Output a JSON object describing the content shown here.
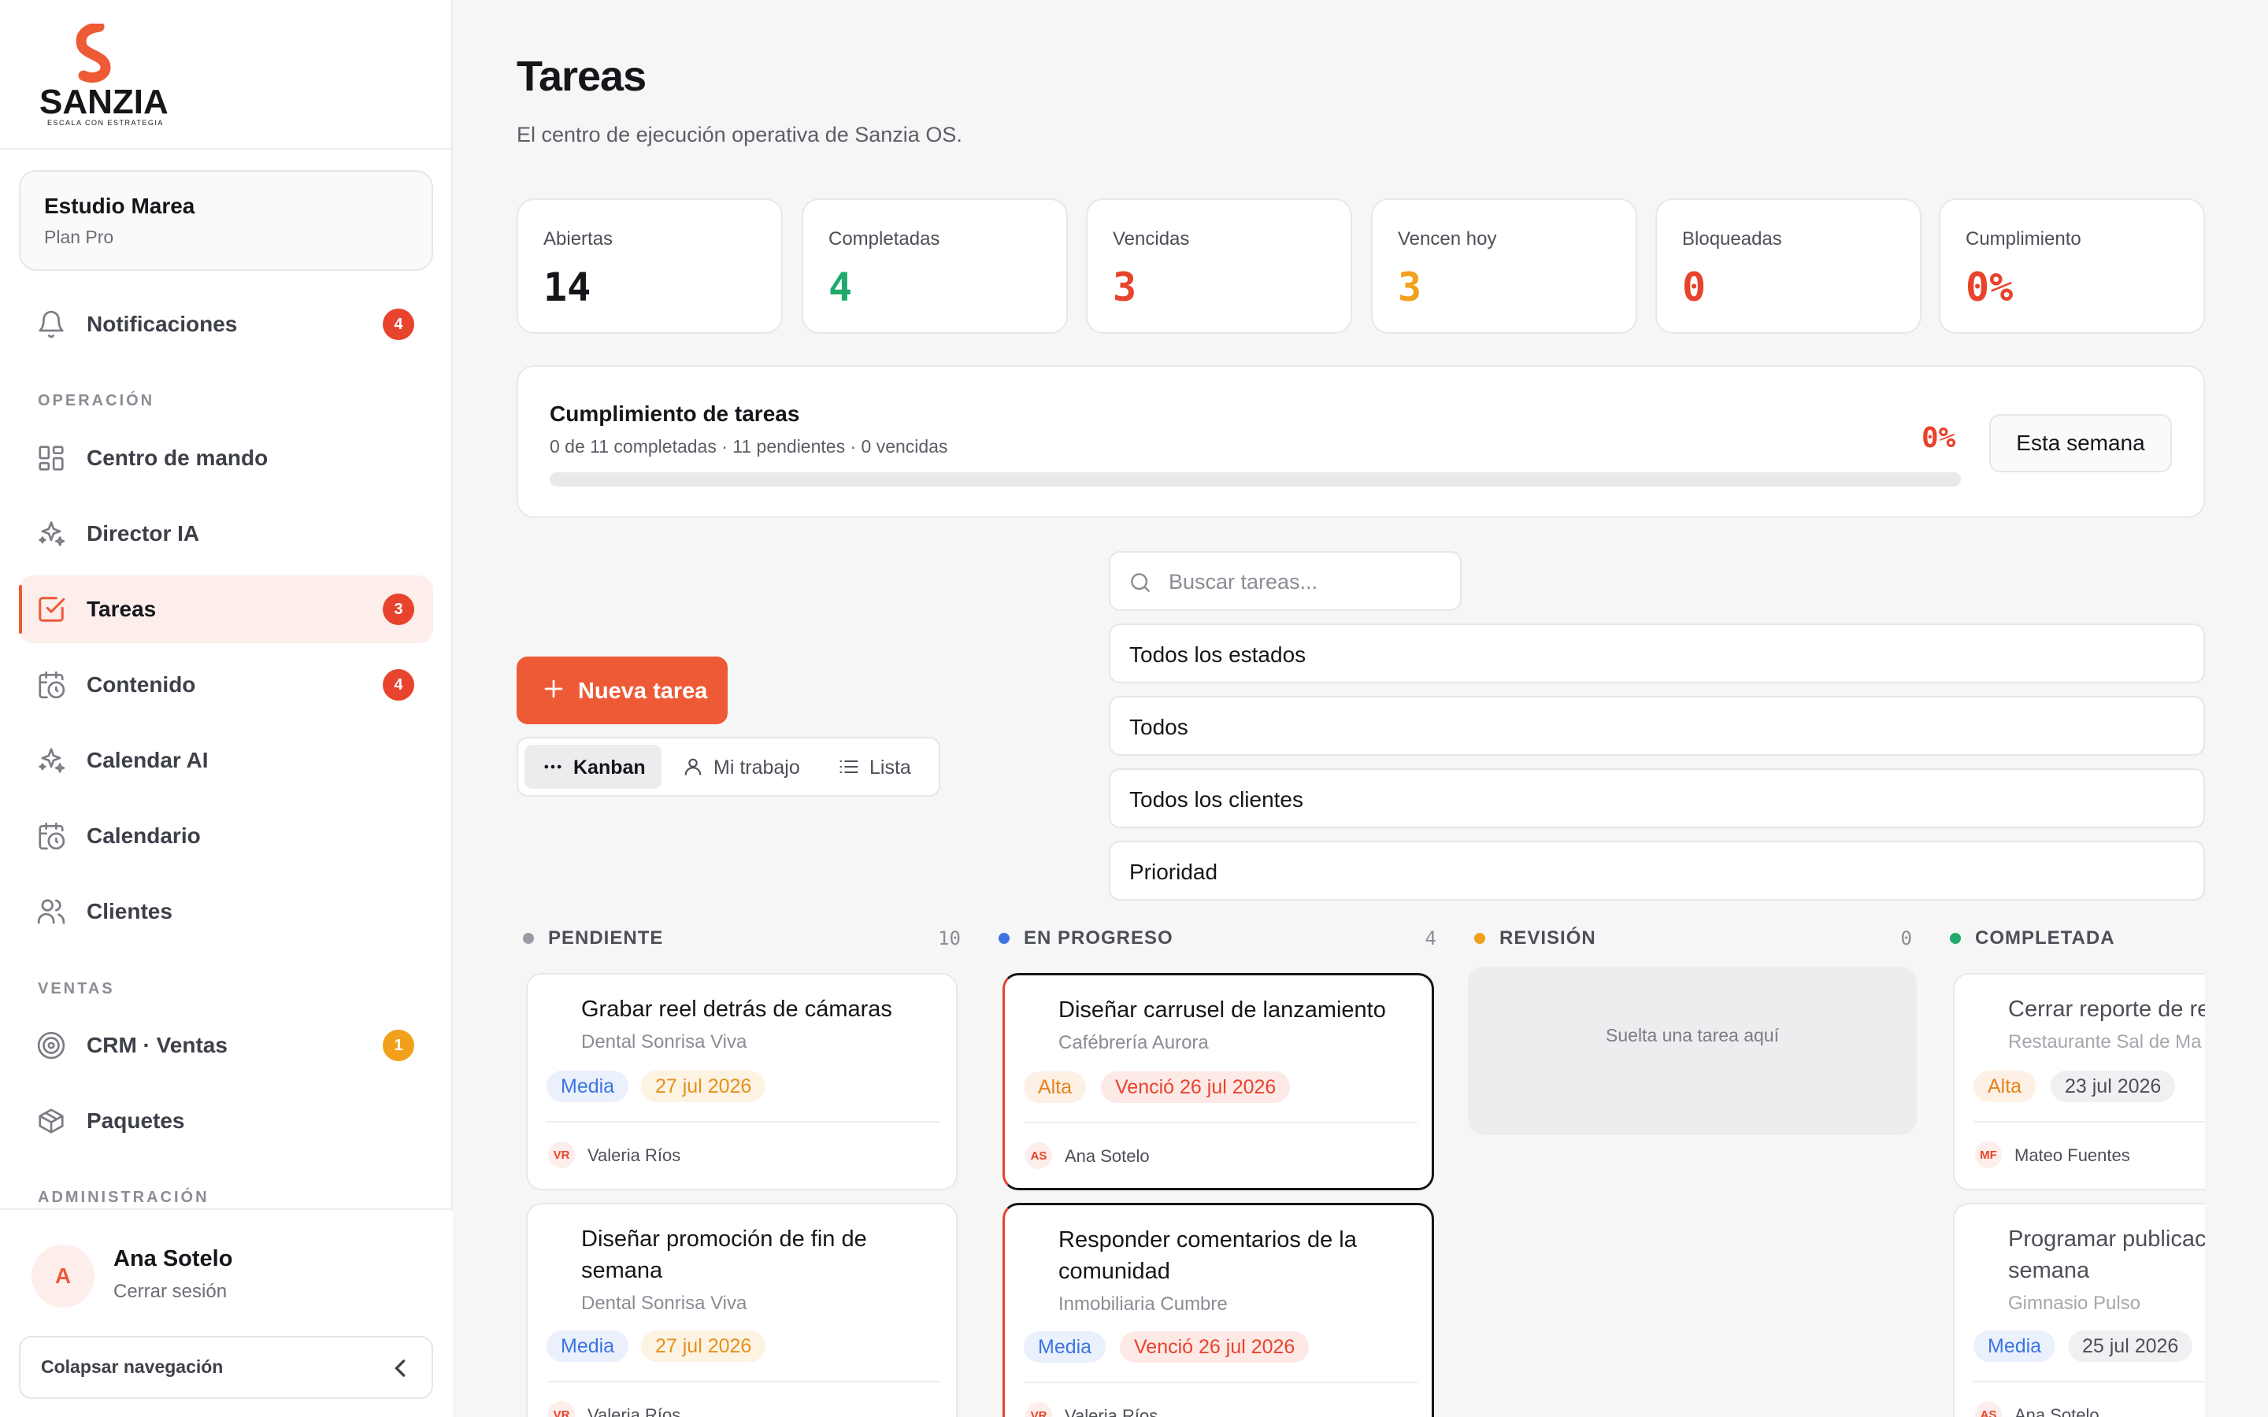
{
  "brand": {
    "name": "SANZIA",
    "tagline": "ESCALA CON ESTRATEGIA",
    "accent": "#ee5a36"
  },
  "workspace": {
    "name": "Estudio Marea",
    "plan": "Plan Pro"
  },
  "sidebar": {
    "notifications": {
      "label": "Notificaciones",
      "badge": "4",
      "icon": "bell-icon"
    },
    "sections": {
      "operacion": "OPERACIÓN",
      "ventas": "VENTAS",
      "administracion": "ADMINISTRACIÓN"
    },
    "items": [
      {
        "label": "Centro de mando",
        "icon": "grid-icon"
      },
      {
        "label": "Director IA",
        "icon": "sparkles-icon"
      },
      {
        "label": "Tareas",
        "icon": "checkbox-icon",
        "badge": "3",
        "active": true
      },
      {
        "label": "Contenido",
        "icon": "calendar-clock-icon",
        "badge": "4"
      },
      {
        "label": "Calendar AI",
        "icon": "sparkles-icon"
      },
      {
        "label": "Calendario",
        "icon": "calendar-clock-icon"
      },
      {
        "label": "Clientes",
        "icon": "users-icon"
      },
      {
        "label": "CRM · Ventas",
        "icon": "target-icon",
        "badge": "1"
      },
      {
        "label": "Paquetes",
        "icon": "package-icon"
      }
    ],
    "user": {
      "initial": "A",
      "name": "Ana Sotelo",
      "logout": "Cerrar sesión"
    },
    "collapse": "Colapsar navegación"
  },
  "header": {
    "title": "Tareas",
    "subtitle": "El centro de ejecución operativa de Sanzia OS."
  },
  "stats": [
    {
      "label": "Abiertas",
      "value": "14",
      "color": "#14161a"
    },
    {
      "label": "Completadas",
      "value": "4",
      "color": "#1faa6b"
    },
    {
      "label": "Vencidas",
      "value": "3",
      "color": "#e8432c"
    },
    {
      "label": "Vencen hoy",
      "value": "3",
      "color": "#f2a01b"
    },
    {
      "label": "Bloqueadas",
      "value": "0",
      "color": "#e8432c"
    },
    {
      "label": "Cumplimiento",
      "value": "0%",
      "color": "#e8432c"
    }
  ],
  "progress": {
    "title": "Cumplimiento de tareas",
    "summary": "0 de 11 completadas · 11 pendientes · 0 vencidas",
    "percent_label": "0%",
    "fraction": 0,
    "period": "Esta semana"
  },
  "toolbar": {
    "new_task": "Nueva tarea",
    "views": [
      {
        "label": "Kanban",
        "icon": "dots-icon",
        "active": true
      },
      {
        "label": "Mi trabajo",
        "icon": "user-icon"
      },
      {
        "label": "Lista",
        "icon": "list-icon"
      }
    ],
    "search_placeholder": "Buscar tareas...",
    "filters": [
      "Todos los estados",
      "Todos",
      "Todos los clientes",
      "Prioridad"
    ]
  },
  "kanban": {
    "columns": [
      {
        "title": "PENDIENTE",
        "count": "10",
        "color": "#9a9ca3"
      },
      {
        "title": "EN PROGRESO",
        "count": "4",
        "color": "#3d74e0"
      },
      {
        "title": "REVISIÓN",
        "count": "0",
        "color": "#f2a01b",
        "empty": "Suelta una tarea aquí"
      },
      {
        "title": "COMPLETADA",
        "count": "",
        "color": "#1faa6b"
      }
    ],
    "pendiente": [
      {
        "title": "Grabar reel detrás de cámaras",
        "client": "Dental Sonrisa Viva",
        "priority": "Media",
        "date": "27 jul 2026",
        "initials": "VR",
        "assignee": "Valeria Ríos"
      },
      {
        "title": "Diseñar promoción de fin de semana",
        "client": "Dental Sonrisa Viva",
        "priority": "Media",
        "date": "27 jul 2026",
        "initials": "VR",
        "assignee": "Valeria Ríos"
      }
    ],
    "progreso": [
      {
        "title": "Diseñar carrusel de lanzamiento",
        "client": "Cafébrería Aurora",
        "priority": "Alta",
        "date": "Venció 26 jul 2026",
        "initials": "AS",
        "assignee": "Ana Sotelo"
      },
      {
        "title": "Responder comentarios de la comunidad",
        "client": "Inmobiliaria Cumbre",
        "priority": "Media",
        "date": "Venció 26 jul 2026",
        "initials": "VR",
        "assignee": "Valeria Ríos"
      }
    ],
    "completada": [
      {
        "title": "Cerrar reporte de re",
        "client": "Restaurante Sal de Ma",
        "priority": "Alta",
        "date": "23 jul 2026",
        "initials": "MF",
        "assignee": "Mateo Fuentes"
      },
      {
        "title": "Programar publicac semana",
        "client": "Gimnasio Pulso",
        "priority": "Media",
        "date": "25 jul 2026",
        "initials": "AS",
        "assignee": "Ana Sotelo"
      }
    ]
  }
}
